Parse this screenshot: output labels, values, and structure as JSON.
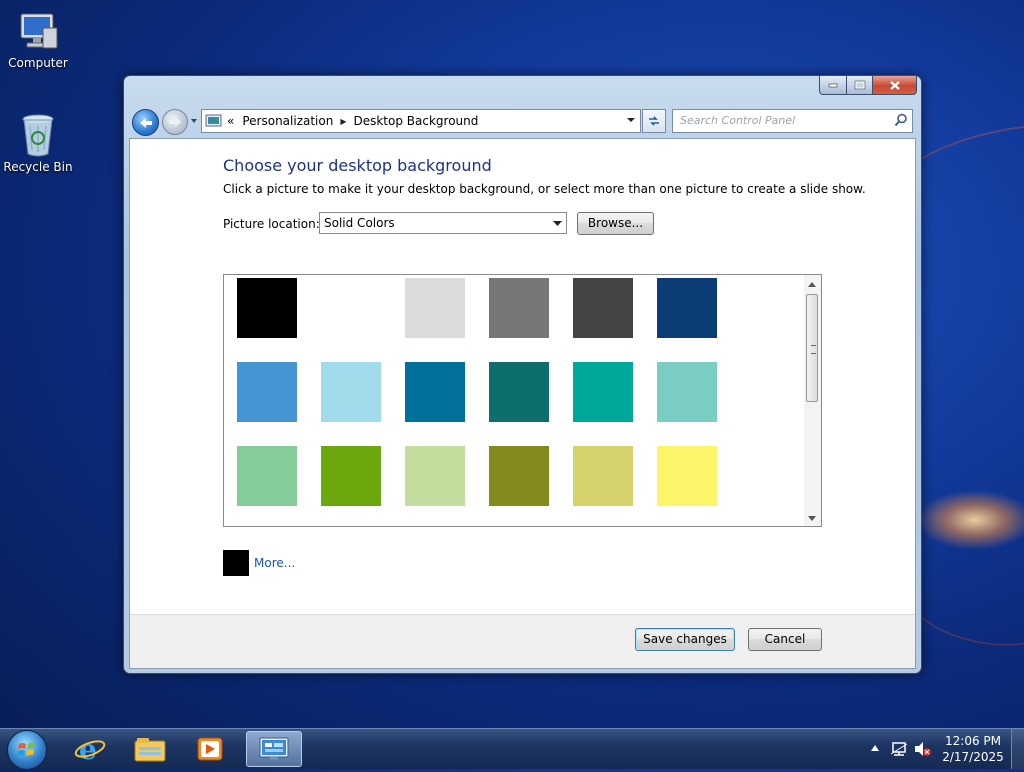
{
  "desktop": {
    "icons": [
      {
        "label": "Computer",
        "icon": "computer-icon"
      },
      {
        "label": "Recycle Bin",
        "icon": "recycle-bin-icon"
      }
    ]
  },
  "window": {
    "address": {
      "crumbs": [
        "Personalization",
        "Desktop Background"
      ],
      "overflow": "«"
    },
    "search": {
      "placeholder": "Search Control Panel"
    },
    "heading": "Choose your desktop background",
    "subtitle": "Click a picture to make it your desktop background, or select more than one picture to create a slide show.",
    "picture_location": {
      "label": "Picture location:",
      "value": "Solid Colors"
    },
    "browse_label": "Browse...",
    "swatches": [
      "#000000",
      "#ffffff",
      "#dcdcdc",
      "#777777",
      "#444444",
      "#0c3c76",
      "#4594d4",
      "#a2dbeb",
      "#01719c",
      "#0d6e6b",
      "#00a89a",
      "#79cdc3",
      "#86cc9a",
      "#6da70e",
      "#c2de9e",
      "#848a1e",
      "#d4d36e",
      "#fcf56a"
    ],
    "more_color": "#000000",
    "more_label": "More...",
    "save_label": "Save changes",
    "cancel_label": "Cancel"
  },
  "taskbar": {
    "pinned": [
      "internet-explorer-icon",
      "file-explorer-icon",
      "media-player-icon",
      "control-panel-icon"
    ],
    "active": "control-panel-icon",
    "time": "12:06 PM",
    "date": "2/17/2025"
  }
}
